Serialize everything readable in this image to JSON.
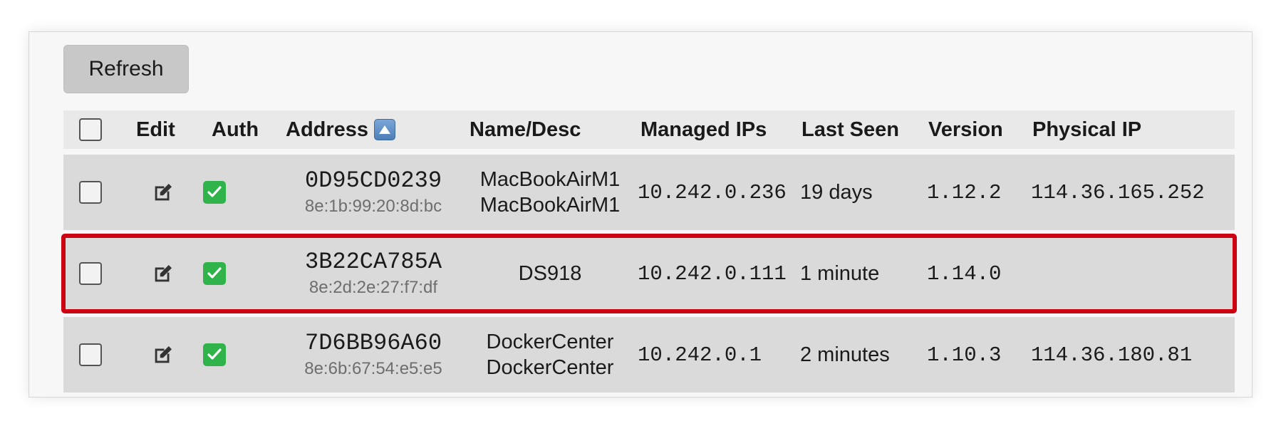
{
  "toolbar": {
    "refresh_label": "Refresh"
  },
  "table": {
    "headers": {
      "edit": "Edit",
      "auth": "Auth",
      "address": "Address",
      "name_desc": "Name/Desc",
      "managed_ips": "Managed IPs",
      "last_seen": "Last Seen",
      "version": "Version",
      "physical_ip": "Physical IP"
    },
    "sort": {
      "column": "address",
      "direction": "ascending",
      "icon": "sort-ascending-icon"
    },
    "rows": [
      {
        "address": "0D95CD0239",
        "mac": "8e:1b:99:20:8d:bc",
        "name": "MacBookAirM1",
        "desc": "MacBookAirM1",
        "managed_ips": "10.242.0.236",
        "last_seen": "19 days",
        "version": "1.12.2",
        "physical_ip": "114.36.165.252"
      },
      {
        "address": "3B22CA785A",
        "mac": "8e:2d:2e:27:f7:df",
        "name": "DS918",
        "desc": "",
        "managed_ips": "10.242.0.111",
        "last_seen": "1 minute",
        "version": "1.14.0",
        "physical_ip": ""
      },
      {
        "address": "7D6BB96A60",
        "mac": "8e:6b:67:54:e5:e5",
        "name": "DockerCenter",
        "desc": "DockerCenter",
        "managed_ips": "10.242.0.1",
        "last_seen": "2 minutes",
        "version": "1.10.3",
        "physical_ip": "114.36.180.81"
      }
    ]
  },
  "colors": {
    "highlight_border": "#cc0011",
    "auth_green": "#2fb34a",
    "row_background": "#dadada",
    "header_background": "#e9e9e9"
  }
}
